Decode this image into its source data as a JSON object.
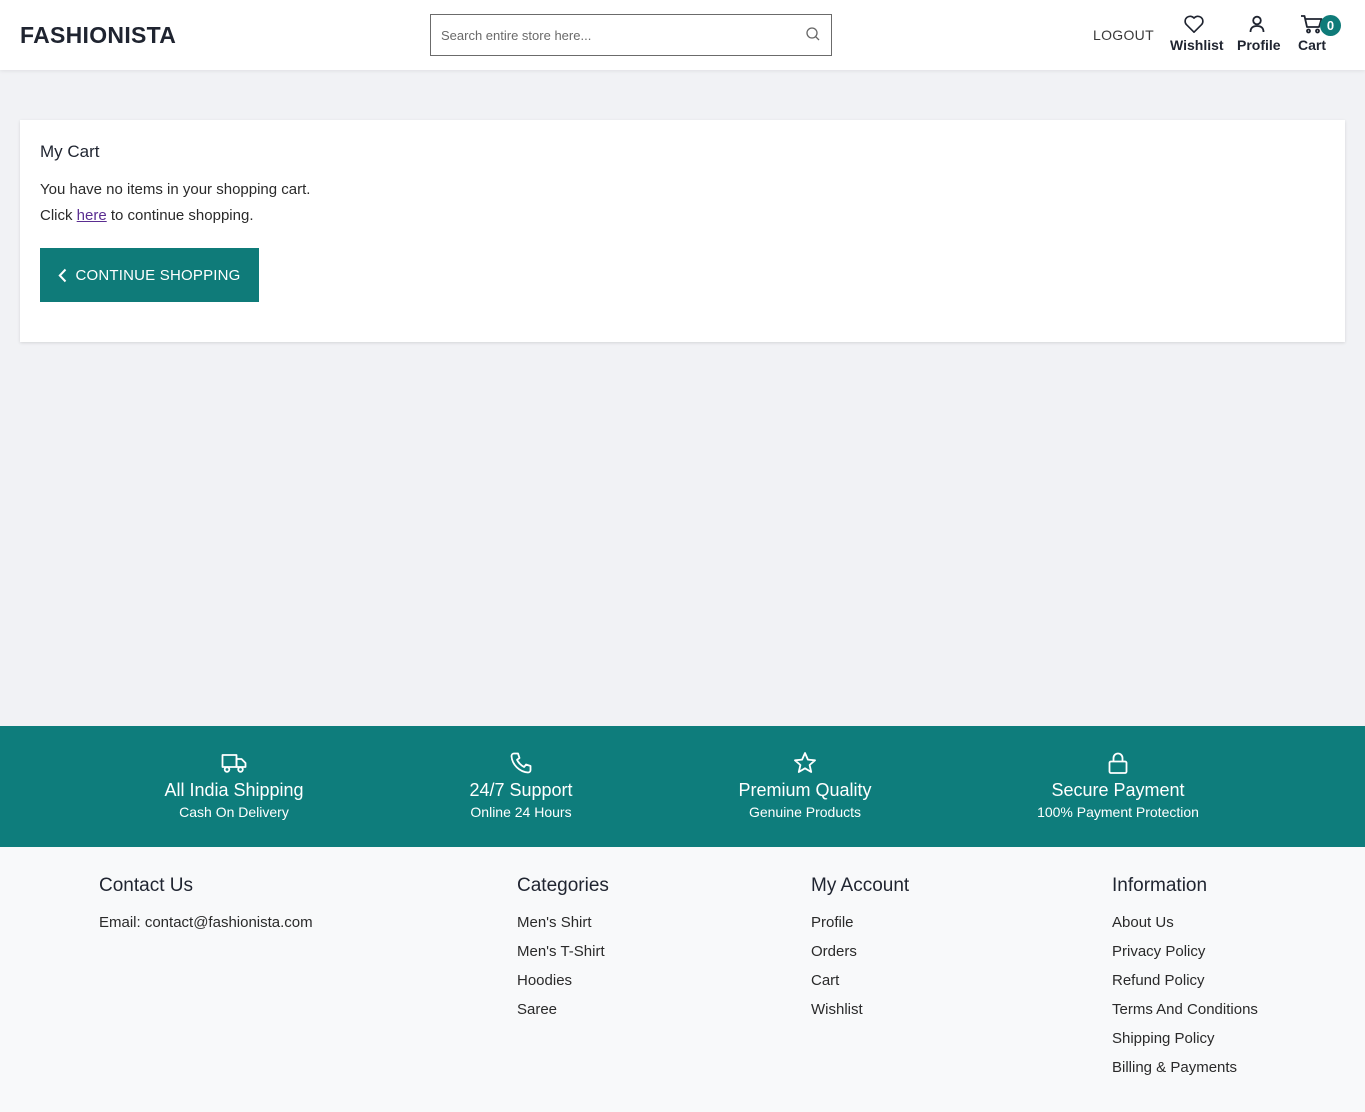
{
  "header": {
    "logo": "FASHIONISTA",
    "search_placeholder": "Search entire store here...",
    "logout": "LOGOUT",
    "wishlist": "Wishlist",
    "profile": "Profile",
    "cart": "Cart",
    "cart_count": "0"
  },
  "cart": {
    "title": "My Cart",
    "empty_message": "You have no items in your shopping cart.",
    "click_prefix": "Click",
    "here_link": "here",
    "click_suffix": "to continue shopping.",
    "continue_button": "CONTINUE SHOPPING"
  },
  "features": [
    {
      "icon": "truck-icon",
      "title": "All India Shipping",
      "subtitle": "Cash On Delivery"
    },
    {
      "icon": "phone-icon",
      "title": "24/7 Support",
      "subtitle": "Online 24 Hours"
    },
    {
      "icon": "star-icon",
      "title": "Premium Quality",
      "subtitle": "Genuine Products"
    },
    {
      "icon": "lock-icon",
      "title": "Secure Payment",
      "subtitle": "100% Payment Protection"
    }
  ],
  "footer": {
    "contact": {
      "title": "Contact Us",
      "email": "Email: contact@fashionista.com"
    },
    "categories": {
      "title": "Categories",
      "items": [
        "Men's Shirt",
        "Men's T-Shirt",
        "Hoodies",
        "Saree"
      ]
    },
    "account": {
      "title": "My Account",
      "items": [
        "Profile",
        "Orders",
        "Cart",
        "Wishlist"
      ]
    },
    "information": {
      "title": "Information",
      "items": [
        "About Us",
        "Privacy Policy",
        "Refund Policy",
        "Terms And Conditions",
        "Shipping Policy",
        "Billing & Payments"
      ]
    }
  },
  "colors": {
    "accent": "#0f7b79",
    "page_bg": "#f1f2f5",
    "footer_bg": "#f8f9fa"
  }
}
